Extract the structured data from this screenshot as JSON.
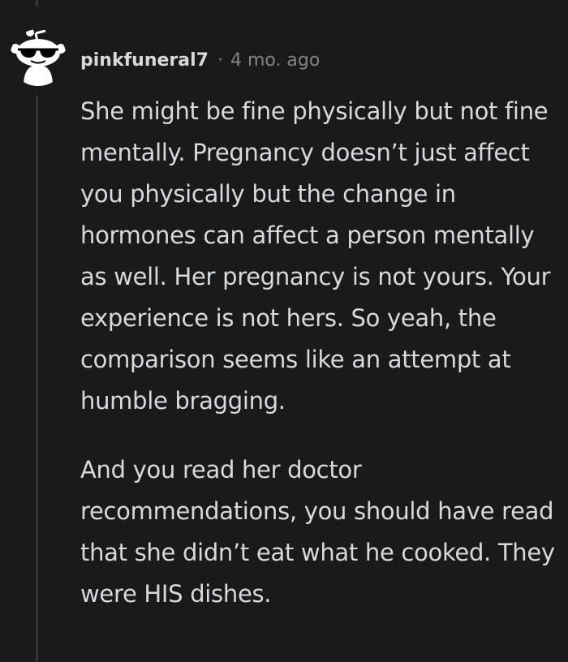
{
  "comment": {
    "avatar_icon": "snoo-sunglasses-avatar-icon",
    "username": "pinkfuneral7",
    "separator": "·",
    "timestamp": "4 mo. ago",
    "paragraphs": [
      "She might be fine physically but not fine mentally. Pregnancy doesn’t just affect you physically but the change in hormones can affect a person mentally as well. Her pregnancy is not yours. Your experience is not hers. So yeah, the comparison seems like an attempt at humble bragging.",
      "And you read her doctor recommendations, you should have read that she didn’t eat what he cooked. They were HIS dishes."
    ]
  },
  "colors": {
    "background": "#1a1a1b",
    "text": "#d7dadc",
    "meta_text": "#818384",
    "thread_line": "#343536"
  }
}
